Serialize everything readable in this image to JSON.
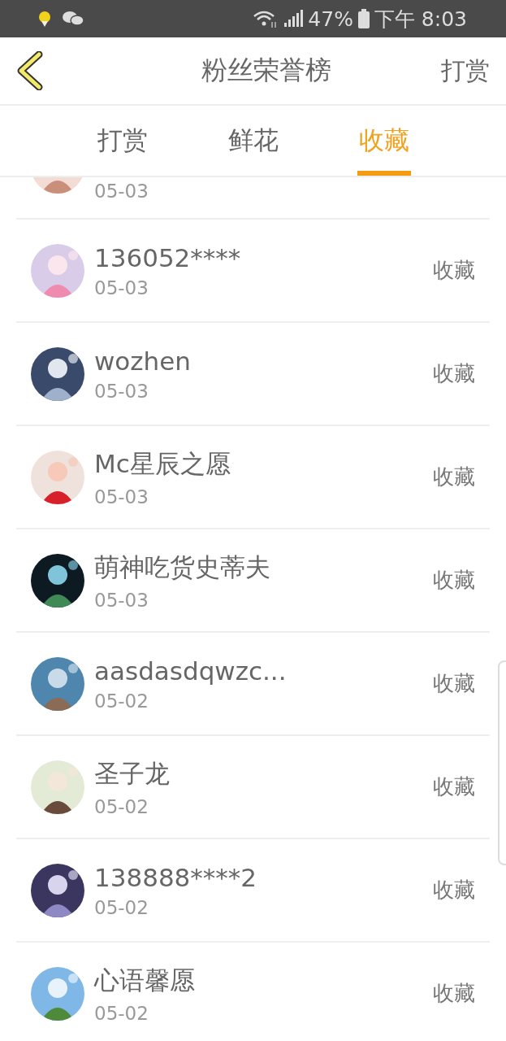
{
  "status_bar": {
    "battery": "47%",
    "time": "下午 8:03"
  },
  "header": {
    "title": "粉丝荣誉榜",
    "action": "打赏"
  },
  "tabs": [
    {
      "label": "打赏",
      "selected": false
    },
    {
      "label": "鲜花",
      "selected": false
    },
    {
      "label": "收藏",
      "selected": true
    }
  ],
  "rows": [
    {
      "date": "05-03"
    },
    {
      "name": "136052****",
      "date": "05-03",
      "action": "收藏"
    },
    {
      "name": "wozhen",
      "date": "05-03",
      "action": "收藏"
    },
    {
      "name": "Mc星辰之愿",
      "date": "05-03",
      "action": "收藏"
    },
    {
      "name": "萌神吃货史蒂夫",
      "date": "05-03",
      "action": "收藏"
    },
    {
      "name": "aasdasdqwzc...",
      "date": "05-02",
      "action": "收藏"
    },
    {
      "name": "圣子龙",
      "date": "05-02",
      "action": "收藏"
    },
    {
      "name": "138888****2",
      "date": "05-02",
      "action": "收藏"
    },
    {
      "name": "心语馨愿",
      "date": "05-02",
      "action": "收藏"
    }
  ]
}
